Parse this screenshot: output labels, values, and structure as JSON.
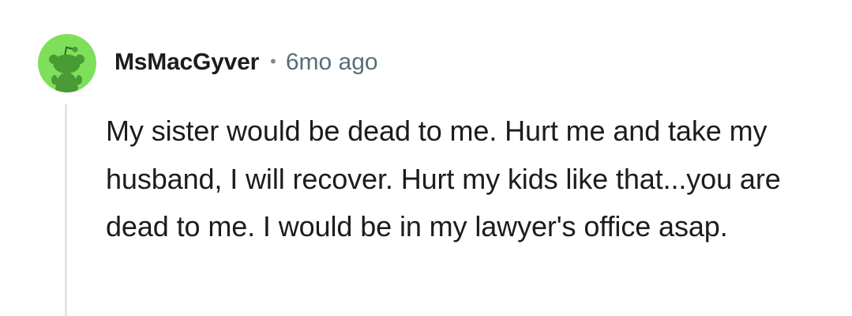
{
  "comment": {
    "author": "MsMacGyver",
    "separator": "•",
    "timestamp": "6mo ago",
    "avatar_icon": "reddit-snoo-avatar-icon",
    "avatar_color": "#7ee05a",
    "body": "My sister would be dead to me. Hurt me and take my husband, I will recover. Hurt my kids like that...you are dead to me. I would be in my lawyer's office asap."
  }
}
